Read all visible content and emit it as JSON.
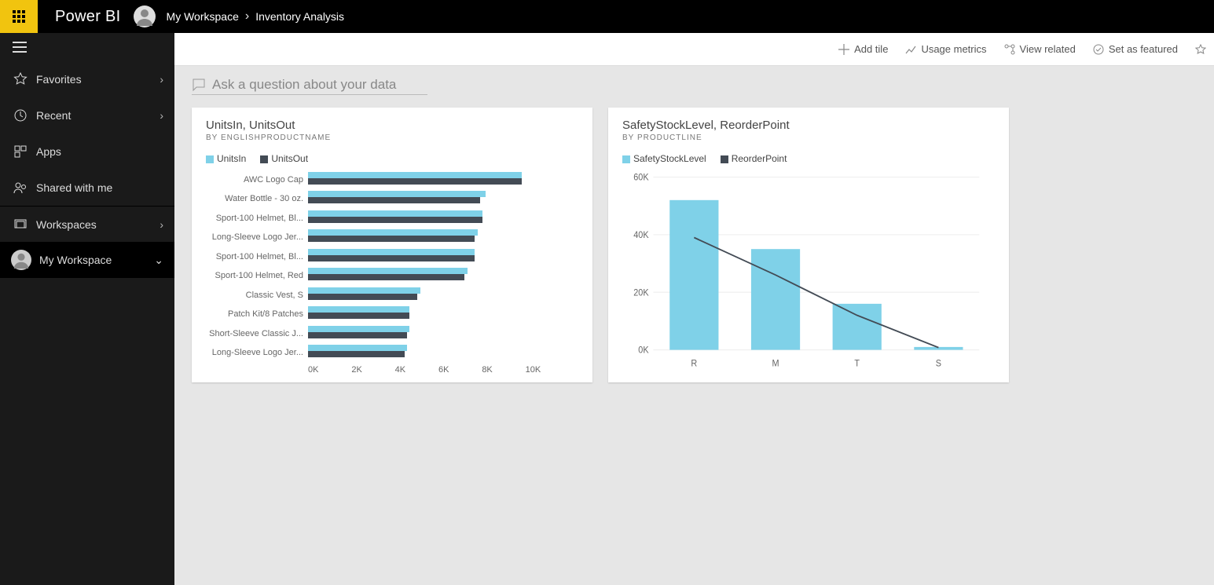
{
  "header": {
    "brand": "Power BI",
    "breadcrumb": [
      "My Workspace",
      "Inventory Analysis"
    ]
  },
  "sidebar": {
    "items": [
      {
        "label": "Favorites",
        "icon": "star"
      },
      {
        "label": "Recent",
        "icon": "clock"
      },
      {
        "label": "Apps",
        "icon": "apps"
      },
      {
        "label": "Shared with me",
        "icon": "people"
      },
      {
        "label": "Workspaces",
        "icon": "workspaces"
      }
    ],
    "current_workspace": "My Workspace"
  },
  "toolbar": {
    "add_tile": "Add tile",
    "usage": "Usage metrics",
    "related": "View related",
    "featured": "Set as featured"
  },
  "qa": {
    "placeholder": "Ask a question about your data"
  },
  "chart_data": [
    {
      "type": "bar",
      "orientation": "horizontal",
      "title": "UnitsIn, UnitsOut",
      "subtitle": "By EnglishProductName",
      "series_names": [
        "UnitsIn",
        "UnitsOut"
      ],
      "categories": [
        "AWC Logo Cap",
        "Water Bottle - 30 oz.",
        "Sport-100 Helmet, Bl...",
        "Long-Sleeve Logo Jer...",
        "Sport-100 Helmet, Bl...",
        "Sport-100 Helmet, Red",
        "Classic Vest, S",
        "Patch Kit/8 Patches",
        "Short-Sleeve Classic J...",
        "Long-Sleeve Logo Jer..."
      ],
      "series": [
        {
          "name": "UnitsIn",
          "values": [
            8200,
            6800,
            6700,
            6500,
            6400,
            6100,
            4300,
            3900,
            3900,
            3800
          ]
        },
        {
          "name": "UnitsOut",
          "values": [
            8200,
            6600,
            6700,
            6400,
            6400,
            6000,
            4200,
            3900,
            3800,
            3700
          ]
        }
      ],
      "xlabel": "",
      "ylabel": "",
      "x_ticks": [
        "0K",
        "2K",
        "4K",
        "6K",
        "8K",
        "10K"
      ],
      "xmax": 10000
    },
    {
      "type": "bar",
      "title": "SafetyStockLevel, ReorderPoint",
      "subtitle": "By ProductLine",
      "series_names": [
        "SafetyStockLevel",
        "ReorderPoint"
      ],
      "categories": [
        "R",
        "M",
        "T",
        "S"
      ],
      "series": [
        {
          "name": "SafetyStockLevel",
          "type": "column",
          "values": [
            52000,
            35000,
            16000,
            1000
          ]
        },
        {
          "name": "ReorderPoint",
          "type": "line",
          "values": [
            39000,
            26000,
            12000,
            800
          ]
        }
      ],
      "y_ticks": [
        "0K",
        "20K",
        "40K",
        "60K"
      ],
      "ylim": [
        0,
        60000
      ]
    }
  ]
}
